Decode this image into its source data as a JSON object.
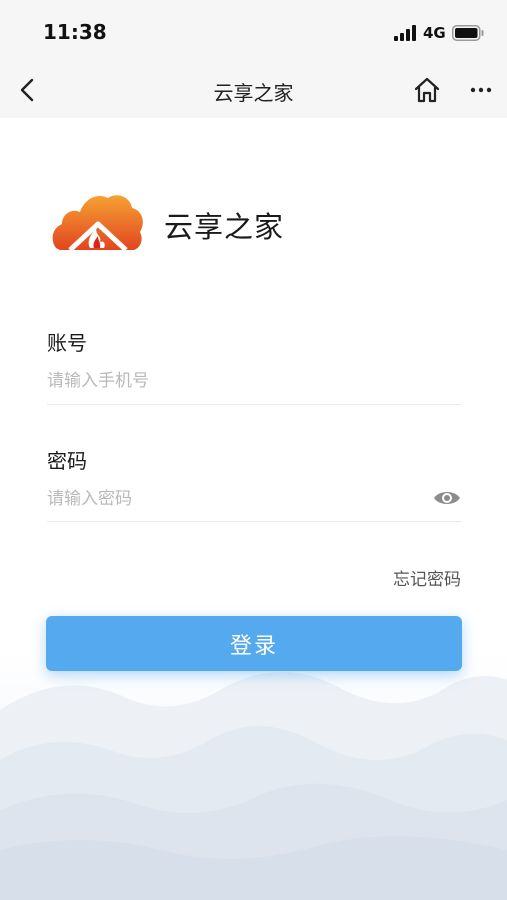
{
  "status_bar": {
    "time": "11:38",
    "network": "4G"
  },
  "nav": {
    "title": "云享之家"
  },
  "app": {
    "name": "云享之家"
  },
  "account": {
    "label": "账号",
    "placeholder": "请输入手机号",
    "value": ""
  },
  "password": {
    "label": "密码",
    "placeholder": "请输入密码",
    "value": ""
  },
  "forgot_label": "忘记密码",
  "login_label": "登录",
  "colors": {
    "primary": "#55a9ee",
    "logo_orange": "#f3832a",
    "logo_red": "#d9261c"
  },
  "icons": [
    "back-icon",
    "home-icon",
    "more-icon",
    "eye-icon",
    "signal-icon",
    "battery-icon"
  ]
}
